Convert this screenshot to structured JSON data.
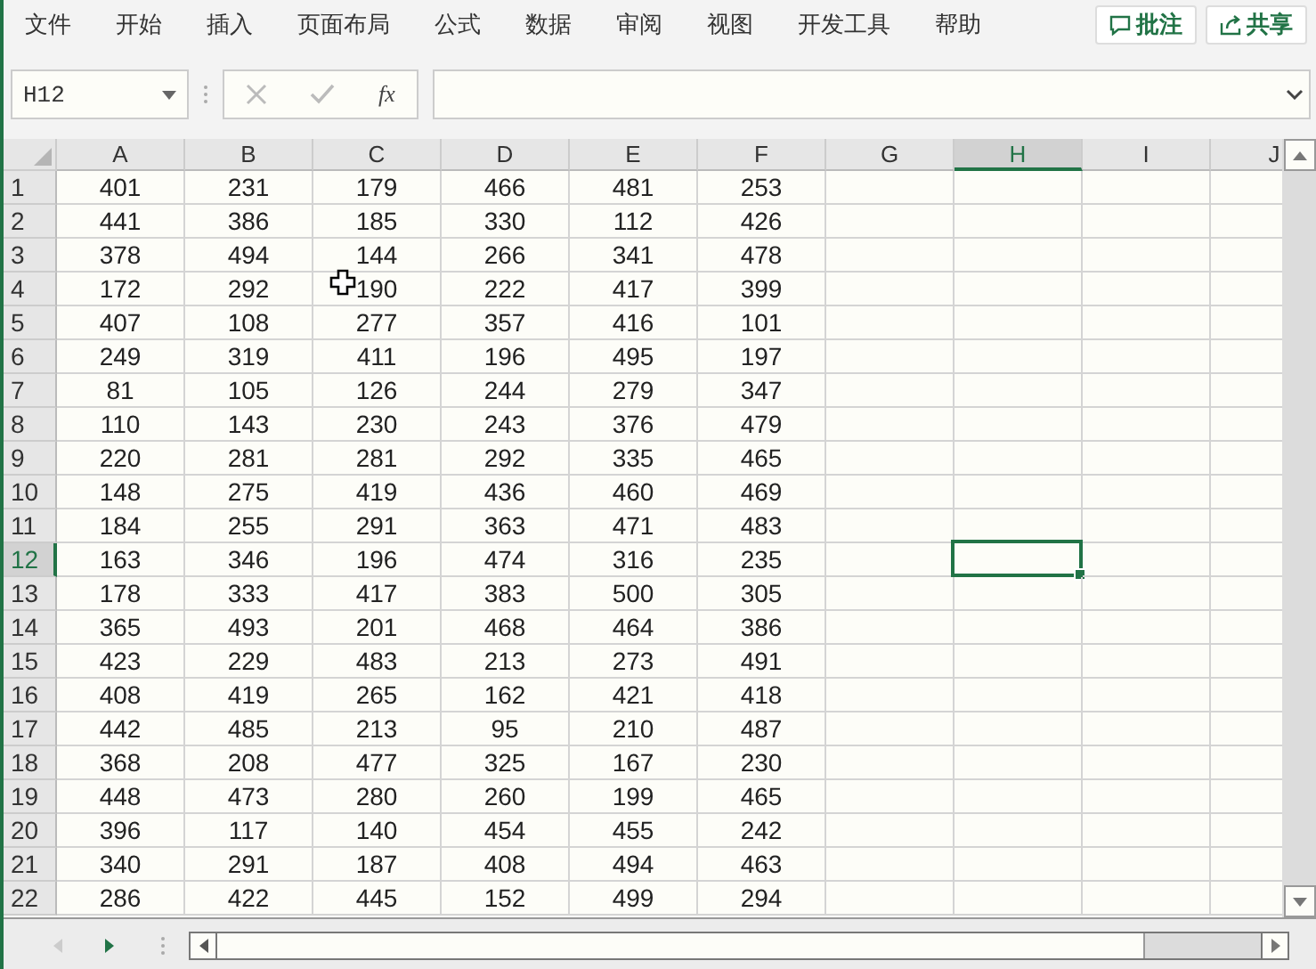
{
  "menu": [
    {
      "label": "文件"
    },
    {
      "label": "开始"
    },
    {
      "label": "插入"
    },
    {
      "label": "页面布局"
    },
    {
      "label": "公式"
    },
    {
      "label": "数据"
    },
    {
      "label": "审阅"
    },
    {
      "label": "视图"
    },
    {
      "label": "开发工具"
    },
    {
      "label": "帮助"
    }
  ],
  "actions": [
    {
      "kind": "comment",
      "label": "批注"
    },
    {
      "kind": "share",
      "label": "共享"
    }
  ],
  "name_box": {
    "value": "H12"
  },
  "formula_buttons": [
    {
      "kind": "cancel"
    },
    {
      "kind": "enter"
    },
    {
      "kind": "function",
      "label": "fx"
    }
  ],
  "columns": [
    {
      "label": "A",
      "selected": false
    },
    {
      "label": "B",
      "selected": false
    },
    {
      "label": "C",
      "selected": false
    },
    {
      "label": "D",
      "selected": false
    },
    {
      "label": "E",
      "selected": false
    },
    {
      "label": "F",
      "selected": false
    },
    {
      "label": "G",
      "selected": false
    },
    {
      "label": "H",
      "selected": true
    },
    {
      "label": "I",
      "selected": false
    },
    {
      "label": "J",
      "selected": false
    }
  ],
  "rows": [
    {
      "label": "1",
      "selected": false,
      "cells": [
        "401",
        "231",
        "179",
        "466",
        "481",
        "253"
      ]
    },
    {
      "label": "2",
      "selected": false,
      "cells": [
        "441",
        "386",
        "185",
        "330",
        "112",
        "426"
      ]
    },
    {
      "label": "3",
      "selected": false,
      "cells": [
        "378",
        "494",
        "144",
        "266",
        "341",
        "478"
      ]
    },
    {
      "label": "4",
      "selected": false,
      "cells": [
        "172",
        "292",
        "190",
        "222",
        "417",
        "399"
      ]
    },
    {
      "label": "5",
      "selected": false,
      "cells": [
        "407",
        "108",
        "277",
        "357",
        "416",
        "101"
      ]
    },
    {
      "label": "6",
      "selected": false,
      "cells": [
        "249",
        "319",
        "411",
        "196",
        "495",
        "197"
      ]
    },
    {
      "label": "7",
      "selected": false,
      "cells": [
        "81",
        "105",
        "126",
        "244",
        "279",
        "347"
      ]
    },
    {
      "label": "8",
      "selected": false,
      "cells": [
        "110",
        "143",
        "230",
        "243",
        "376",
        "479"
      ]
    },
    {
      "label": "9",
      "selected": false,
      "cells": [
        "220",
        "281",
        "281",
        "292",
        "335",
        "465"
      ]
    },
    {
      "label": "10",
      "selected": false,
      "cells": [
        "148",
        "275",
        "419",
        "436",
        "460",
        "469"
      ]
    },
    {
      "label": "11",
      "selected": false,
      "cells": [
        "184",
        "255",
        "291",
        "363",
        "471",
        "483"
      ]
    },
    {
      "label": "12",
      "selected": true,
      "cells": [
        "163",
        "346",
        "196",
        "474",
        "316",
        "235"
      ]
    },
    {
      "label": "13",
      "selected": false,
      "cells": [
        "178",
        "333",
        "417",
        "383",
        "500",
        "305"
      ]
    },
    {
      "label": "14",
      "selected": false,
      "cells": [
        "365",
        "493",
        "201",
        "468",
        "464",
        "386"
      ]
    },
    {
      "label": "15",
      "selected": false,
      "cells": [
        "423",
        "229",
        "483",
        "213",
        "273",
        "491"
      ]
    },
    {
      "label": "16",
      "selected": false,
      "cells": [
        "408",
        "419",
        "265",
        "162",
        "421",
        "418"
      ]
    },
    {
      "label": "17",
      "selected": false,
      "cells": [
        "442",
        "485",
        "213",
        "95",
        "210",
        "487"
      ]
    },
    {
      "label": "18",
      "selected": false,
      "cells": [
        "368",
        "208",
        "477",
        "325",
        "167",
        "230"
      ]
    },
    {
      "label": "19",
      "selected": false,
      "cells": [
        "448",
        "473",
        "280",
        "260",
        "199",
        "465"
      ]
    },
    {
      "label": "20",
      "selected": false,
      "cells": [
        "396",
        "117",
        "140",
        "454",
        "455",
        "242"
      ]
    },
    {
      "label": "21",
      "selected": false,
      "cells": [
        "340",
        "291",
        "187",
        "408",
        "494",
        "463"
      ]
    },
    {
      "label": "22",
      "selected": false,
      "cells": [
        "286",
        "422",
        "445",
        "152",
        "499",
        "294"
      ]
    }
  ]
}
